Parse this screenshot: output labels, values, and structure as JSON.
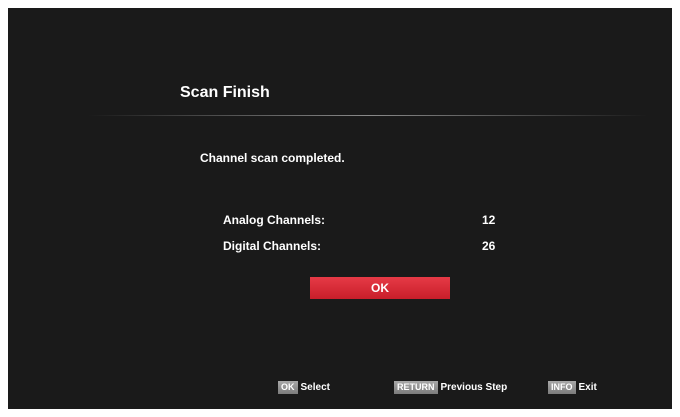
{
  "dialog": {
    "title": "Scan Finish",
    "message": "Channel scan completed.",
    "rows": [
      {
        "label": "Analog Channels:",
        "value": "12"
      },
      {
        "label": "Digital Channels:",
        "value": "26"
      }
    ],
    "ok_label": "OK"
  },
  "footer": {
    "hints": [
      {
        "key": "OK",
        "action": "Select"
      },
      {
        "key": "RETURN",
        "action": "Previous Step"
      },
      {
        "key": "INFO",
        "action": "Exit"
      }
    ]
  },
  "colors": {
    "background": "#1a1a1a",
    "accent": "#d8262f",
    "key_badge": "#8c8c8c",
    "text": "#ffffff"
  }
}
